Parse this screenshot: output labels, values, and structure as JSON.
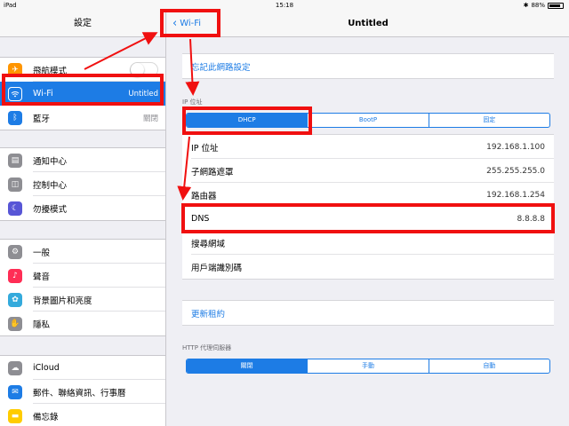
{
  "status_bar": {
    "device": "iPad",
    "time": "15:18",
    "battery": "88%",
    "battery_level": 0.88
  },
  "sidebar": {
    "title": "設定",
    "groups": [
      {
        "items": [
          {
            "label": "飛航模式",
            "icon": "airplane-icon",
            "color": "#ff9500",
            "control": "toggle"
          },
          {
            "label": "Wi-Fi",
            "value": "Untitled",
            "icon": "wifi-icon",
            "color": "#1d7ce5",
            "selected": true
          },
          {
            "label": "藍牙",
            "value": "關閉",
            "icon": "bluetooth-icon",
            "color": "#1d7ce5"
          }
        ]
      },
      {
        "items": [
          {
            "label": "通知中心",
            "icon": "notification-center-icon",
            "color": "#8e8e93"
          },
          {
            "label": "控制中心",
            "icon": "control-center-icon",
            "color": "#8e8e93"
          },
          {
            "label": "勿擾模式",
            "icon": "moon-icon",
            "color": "#5856d6"
          }
        ]
      },
      {
        "items": [
          {
            "label": "一般",
            "icon": "gear-icon",
            "color": "#8e8e93"
          },
          {
            "label": "聲音",
            "icon": "speaker-icon",
            "color": "#ff2d55"
          },
          {
            "label": "背景圖片和亮度",
            "icon": "wallpaper-icon",
            "color": "#34aadc"
          },
          {
            "label": "隱私",
            "icon": "hand-icon",
            "color": "#8e8e93"
          }
        ]
      },
      {
        "items": [
          {
            "label": "iCloud",
            "icon": "cloud-icon",
            "color": "#8e8e93"
          },
          {
            "label": "郵件、聯絡資訊、行事曆",
            "icon": "mail-icon",
            "color": "#1d7ce5"
          },
          {
            "label": "備忘錄",
            "icon": "notes-icon",
            "color": "#ffcc00"
          }
        ]
      }
    ]
  },
  "nav": {
    "back_label": "Wi-Fi",
    "title": "Untitled"
  },
  "forget": {
    "label": "忘記此網路設定"
  },
  "ip": {
    "section_label": "IP 位址",
    "modes": [
      {
        "label": "DHCP",
        "active": true
      },
      {
        "label": "BootP"
      },
      {
        "label": "固定"
      }
    ],
    "rows": [
      {
        "label": "IP 位址",
        "value": "192.168.1.100"
      },
      {
        "label": "子網路遮罩",
        "value": "255.255.255.0"
      },
      {
        "label": "路由器",
        "value": "192.168.1.254"
      },
      {
        "label": "DNS",
        "value": "8.8.8.8"
      },
      {
        "label": "搜尋網域",
        "value": ""
      },
      {
        "label": "用戶端識別碼",
        "value": ""
      }
    ]
  },
  "renew": {
    "label": "更新租約"
  },
  "proxy": {
    "section_label": "HTTP 代理伺服器",
    "modes": [
      {
        "label": "關閉",
        "active": true
      },
      {
        "label": "手動"
      },
      {
        "label": "自動"
      }
    ]
  },
  "colors": {
    "accent": "#1d7ce5",
    "annotation": "#f01010"
  }
}
